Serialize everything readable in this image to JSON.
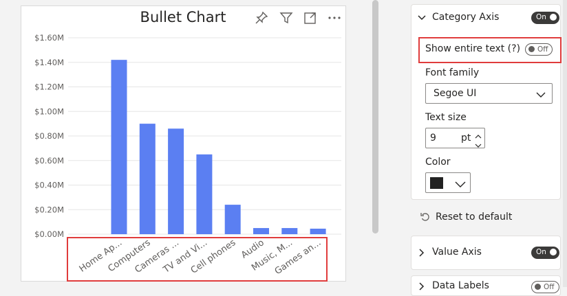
{
  "visual": {
    "title": "Bullet Chart",
    "header_icons": [
      "pin-icon",
      "filter-icon",
      "focus-mode-icon",
      "more-options-icon"
    ]
  },
  "chart_data": {
    "type": "bar",
    "title": "Bullet Chart",
    "categories": [
      "Home Ap...",
      "Computers",
      "Cameras ...",
      "TV and Vi...",
      "Cell phones",
      "Audio",
      "Music, M...",
      "Games an..."
    ],
    "values": [
      1.42,
      0.9,
      0.86,
      0.65,
      0.24,
      0.05,
      0.05,
      0.045
    ],
    "value_unit": "$M",
    "y_ticks": [
      "$0.00M",
      "$0.20M",
      "$0.40M",
      "$0.60M",
      "$0.80M",
      "$1.00M",
      "$1.20M",
      "$1.40M",
      "$1.60M"
    ],
    "ylim": [
      0,
      1.6
    ],
    "grid": true,
    "color": "#5b7ff2"
  },
  "format_pane": {
    "category_axis": {
      "label": "Category Axis",
      "toggle": "On",
      "show_entire_text_label": "Show entire text (?)",
      "show_entire_text_toggle": "Off",
      "font_family_label": "Font family",
      "font_family_value": "Segoe UI",
      "text_size_label": "Text size",
      "text_size_value": "9",
      "text_size_unit": "pt",
      "color_label": "Color",
      "color_value": "#222222"
    },
    "reset_label": "Reset to default",
    "value_axis": {
      "label": "Value Axis",
      "toggle": "On"
    },
    "data_labels": {
      "label": "Data Labels",
      "toggle": "Off"
    }
  },
  "colors": {
    "highlight": "#e03c3c",
    "bar": "#5b7ff2",
    "toggle_on": "#3b3a39"
  }
}
